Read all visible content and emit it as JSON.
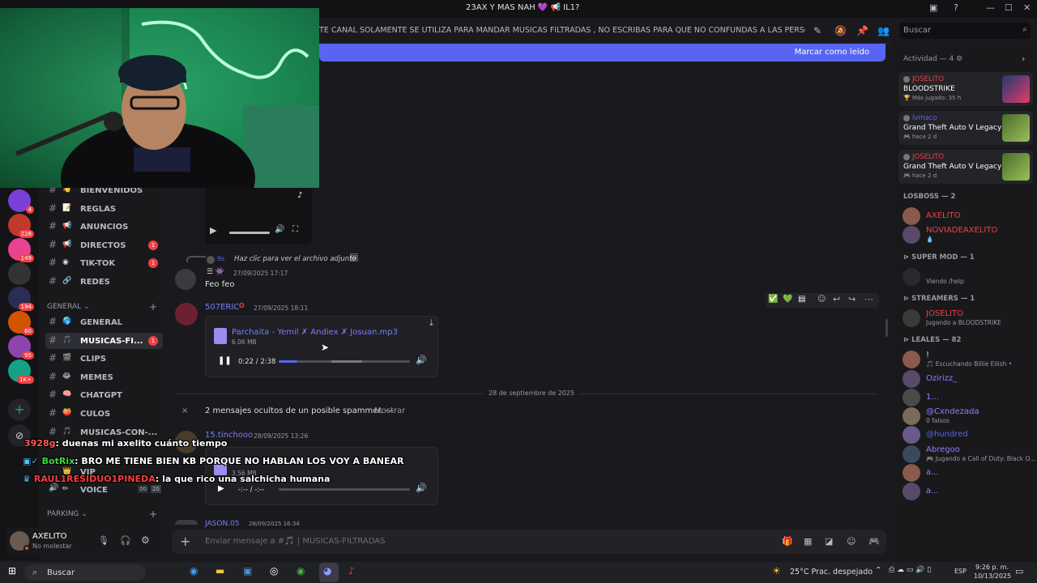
{
  "window": {
    "title": "23AX Y MAS NAH 💜 📢 IL1?"
  },
  "header": {
    "topic": "TE CANAL SOLAMENTE SE UTILIZA PARA MANDAR MUSICAS FILTRADAS , NO ESCRIBAS PARA QUE NO CONFUNDAS A LAS PERSONAS QUE B...",
    "search_placeholder": "Buscar"
  },
  "new_messages_bar": {
    "label": "Marcar como leído"
  },
  "servers": [
    {
      "badge": "4",
      "color": "#7a3fd6"
    },
    {
      "badge": "228",
      "color": "#c0392b"
    },
    {
      "badge": "149",
      "color": "#e84393"
    },
    {
      "badge": "",
      "color": "#333"
    },
    {
      "badge": "194",
      "color": "#2c2c54"
    },
    {
      "badge": "60",
      "color": "#d35400"
    },
    {
      "badge": "95",
      "color": "#8e44ad"
    },
    {
      "badge": "1K+",
      "color": "#16a085"
    }
  ],
  "channels": {
    "top": [
      {
        "emoji": "👋",
        "name": "BIENVENIDOS",
        "badge": ""
      },
      {
        "emoji": "📝",
        "name": "REGLAS",
        "badge": ""
      },
      {
        "emoji": "📢",
        "name": "ANUNCIOS",
        "badge": ""
      },
      {
        "emoji": "📢",
        "name": "DIRECTOS",
        "badge": "1"
      },
      {
        "emoji": "◉",
        "name": "TIK-TOK",
        "badge": "1"
      },
      {
        "emoji": "🔗",
        "name": "REDES",
        "badge": ""
      }
    ],
    "general_category": "GENERAL",
    "general": [
      {
        "emoji": "🌎",
        "name": "GENERAL",
        "badge": ""
      },
      {
        "emoji": "🎵",
        "name": "MUSICAS-FI...",
        "badge": "1"
      },
      {
        "emoji": "🎬",
        "name": "CLIPS",
        "badge": ""
      },
      {
        "emoji": "😂",
        "name": "MEMES",
        "badge": ""
      },
      {
        "emoji": "🧠",
        "name": "CHATGPT",
        "badge": ""
      },
      {
        "emoji": "🍑",
        "name": "CULOS",
        "badge": ""
      },
      {
        "emoji": "🎵",
        "name": "MUSICAS-CON-...",
        "badge": ""
      }
    ],
    "vip": "VIP",
    "voice": {
      "name": "VOICE",
      "a": "00",
      "b": "20"
    },
    "parking_category": "PARKING"
  },
  "user": {
    "name": "AXELITO",
    "status": "No molestar"
  },
  "messages": {
    "reply_text": "Haz clic para ver el archivo adjunto",
    "reply_user": "9s",
    "msg1_ts": "27/09/2025 17:17",
    "msg1_text": "Feo feo",
    "msg2_author": "507ERIC",
    "msg2_ts": "27/09/2025 18:11",
    "file_name": "Parchaita - Yemil ✗ Andiex ✗ Josuan.mp3",
    "file_size": "6.06 MB",
    "player_time": "0:22 / 2:38",
    "player_progress": 0.14,
    "date_divider": "28 de septiembre de 2025",
    "hidden_spam": "2 mensajes ocultos de un posible spammer. —",
    "hidden_show": "Mostrar",
    "msg3_author": "15.tinchooo",
    "msg3_ts": "28/09/2025 13:26",
    "file2_size": "3.56 MB",
    "player2_time": "-:-- / -:--",
    "msg4_author": "JASON.05",
    "msg4_ts": "28/09/2025 16:34"
  },
  "composer": {
    "placeholder": "Enviar mensaje a #🎵 | MUSICAS-FILTRADAS"
  },
  "members": {
    "activity_header": "Actividad — 4",
    "activities": [
      {
        "user": "JOSELITO",
        "user_color": "#f23f43",
        "game": "BLOODSTRIKE",
        "sub": "🏆 Más jugado: 35 h"
      },
      {
        "user": "lvmaco",
        "user_color": "#5865f2",
        "game": "Grand Theft Auto V Legacy",
        "sub": "🎮 hace 2 d"
      },
      {
        "user": "JOSELITO",
        "user_color": "#f23f43",
        "game": "Grand Theft Auto V Legacy",
        "sub": "🎮 hace 2 d"
      }
    ],
    "losboss_header": "LOSBOSS — 2",
    "losboss": [
      {
        "name": "AXELITO",
        "color": "#f23f43",
        "sub": ""
      },
      {
        "name": "NOVIADEAXELITO",
        "color": "#f23f43",
        "sub": "💧"
      }
    ],
    "supermod_header": "⊳ SUPER MOD — 1",
    "supermod": [
      {
        "name": "",
        "color": "#dbdee1",
        "sub": "Viendo /help"
      }
    ],
    "streamers_header": "⊳ STREAMERS — 1",
    "streamers": [
      {
        "name": "JOSELITO",
        "color": "#f23f43",
        "sub": "Jugando a BLOODSTRIKE"
      }
    ],
    "leales_header": "⊳ LEALES — 82",
    "leales": [
      {
        "name": "!",
        "color": "#dbdee1",
        "sub": "🎵 Escuchando Billie Eilish •"
      },
      {
        "name": "Ozirizz_",
        "color": "#9b7bff",
        "sub": ""
      },
      {
        "name": "1...",
        "color": "#9b7bff",
        "sub": ""
      },
      {
        "name": "@Cxndezada",
        "color": "#9b7bff",
        "sub": "0 falsos"
      },
      {
        "name": "@hundred",
        "color": "#5865f2",
        "sub": ""
      },
      {
        "name": "Abregoo",
        "color": "#9b7bff",
        "sub": "🎮 Jugando a Call of Duty: Black O..."
      },
      {
        "name": "a...",
        "color": "#9b7bff",
        "sub": ""
      },
      {
        "name": "a...",
        "color": "#9b7bff",
        "sub": ""
      }
    ]
  },
  "stream_chat": [
    {
      "user": "3928g",
      "user_color": "#ff5a5a",
      "text": ": duenas mi axelito cuánto tiempo"
    },
    {
      "user": "BotRix",
      "user_color": "#3ddc3d",
      "text": ": BRO ME TIENE BIEN KB PORQUE NO HABLAN LOS VOY A BANEAR"
    },
    {
      "user": "RAUL1RESIDUO1PINEDA",
      "user_color": "#ff3b3b",
      "text": ": la que rico una salchicha humana"
    }
  ],
  "taskbar": {
    "search": "Buscar",
    "weather": "25°C  Prac. despejado",
    "lang": "ESP",
    "time": "9:26 p. m.",
    "date": "10/13/2025"
  }
}
